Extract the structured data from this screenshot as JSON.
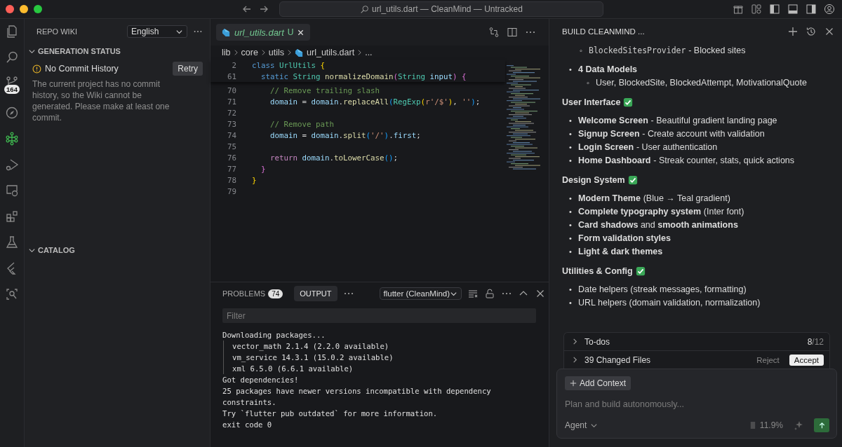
{
  "window": {
    "title": "url_utils.dart — CleanMind — Untracked"
  },
  "activity_bar": [
    {
      "kind": "files",
      "selected": false
    },
    {
      "kind": "search",
      "selected": false
    },
    {
      "kind": "source-control",
      "selected": false,
      "badge": "164"
    },
    {
      "kind": "compass",
      "selected": false
    },
    {
      "kind": "wiki",
      "selected": true
    },
    {
      "kind": "run-debug",
      "selected": false
    },
    {
      "kind": "remote",
      "selected": false
    },
    {
      "kind": "extensions",
      "selected": false
    },
    {
      "kind": "testing",
      "selected": false
    },
    {
      "kind": "flutter",
      "selected": false
    },
    {
      "kind": "inspect",
      "selected": false
    }
  ],
  "side_panel": {
    "title": "REPO WIKI",
    "language": "English",
    "sections": [
      {
        "title": "GENERATION STATUS",
        "expanded": true,
        "status": {
          "title": "No Commit History",
          "action": "Retry",
          "message": "The current project has no commit history, so the Wiki cannot be generated. Please make at least one commit."
        }
      },
      {
        "title": "CATALOG",
        "expanded": true
      }
    ]
  },
  "editor": {
    "tab": {
      "name": "url_utils.dart",
      "status": "U"
    },
    "breadcrumb": [
      "lib",
      "core",
      "utils",
      "url_utils.dart",
      "..."
    ],
    "sticky_lines": [
      {
        "number": "2",
        "tokens": [
          {
            "text": "class",
            "kind": "keyword"
          },
          {
            "text": " UrlUtils",
            "kind": "type"
          },
          {
            "text": " {",
            "kind": "bracket1"
          }
        ]
      },
      {
        "number": "61",
        "tokens": [
          {
            "text": "  static",
            "kind": "keyword"
          },
          {
            "text": " String",
            "kind": "type"
          },
          {
            "text": " normalizeDomain",
            "kind": "function"
          },
          {
            "text": "(",
            "kind": "bracket2"
          },
          {
            "text": "String",
            "kind": "type"
          },
          {
            "text": " input",
            "kind": "variable"
          },
          {
            "text": ")",
            "kind": "bracket2"
          },
          {
            "text": " {",
            "kind": "bracket2"
          }
        ]
      }
    ],
    "lines": [
      {
        "number": "70",
        "tokens": [
          {
            "text": "    // Remove trailing slash",
            "kind": "comment"
          }
        ]
      },
      {
        "number": "71",
        "tokens": [
          {
            "text": "    domain",
            "kind": "variable"
          },
          {
            "text": " = ",
            "kind": "plain"
          },
          {
            "text": "domain",
            "kind": "variable"
          },
          {
            "text": ".",
            "kind": "plain"
          },
          {
            "text": "replaceAll",
            "kind": "function"
          },
          {
            "text": "(",
            "kind": "bracket3"
          },
          {
            "text": "RegExp",
            "kind": "type"
          },
          {
            "text": "(",
            "kind": "bracket1"
          },
          {
            "text": "r'/$'",
            "kind": "string"
          },
          {
            "text": ")",
            "kind": "bracket1"
          },
          {
            "text": ", ",
            "kind": "plain"
          },
          {
            "text": "''",
            "kind": "string"
          },
          {
            "text": ")",
            "kind": "bracket3"
          },
          {
            "text": ";",
            "kind": "plain"
          }
        ]
      },
      {
        "number": "72"
      },
      {
        "number": "73",
        "tokens": [
          {
            "text": "    // Remove path",
            "kind": "comment"
          }
        ]
      },
      {
        "number": "74",
        "tokens": [
          {
            "text": "    domain",
            "kind": "variable"
          },
          {
            "text": " = ",
            "kind": "plain"
          },
          {
            "text": "domain",
            "kind": "variable"
          },
          {
            "text": ".",
            "kind": "plain"
          },
          {
            "text": "split",
            "kind": "function"
          },
          {
            "text": "(",
            "kind": "bracket3"
          },
          {
            "text": "'/'",
            "kind": "string"
          },
          {
            "text": ")",
            "kind": "bracket3"
          },
          {
            "text": ".",
            "kind": "plain"
          },
          {
            "text": "first",
            "kind": "variable"
          },
          {
            "text": ";",
            "kind": "plain"
          }
        ]
      },
      {
        "number": "75"
      },
      {
        "number": "76",
        "tokens": [
          {
            "text": "    return",
            "kind": "control"
          },
          {
            "text": " domain",
            "kind": "variable"
          },
          {
            "text": ".",
            "kind": "plain"
          },
          {
            "text": "toLowerCase",
            "kind": "function"
          },
          {
            "text": "()",
            "kind": "bracket3"
          },
          {
            "text": ";",
            "kind": "plain"
          }
        ]
      },
      {
        "number": "77",
        "tokens": [
          {
            "text": "  }",
            "kind": "bracket2"
          }
        ]
      },
      {
        "number": "78",
        "tokens": [
          {
            "text": "}",
            "kind": "bracket1"
          }
        ]
      },
      {
        "number": "79"
      }
    ]
  },
  "panel": {
    "tabs": [
      {
        "label": "PROBLEMS",
        "badge": "74",
        "selected": false
      },
      {
        "label": "OUTPUT",
        "selected": true
      }
    ],
    "channel": "flutter (CleanMind)",
    "filter_placeholder": "Filter",
    "output": [
      {
        "text": "Downloading packages...",
        "kind": "plain"
      },
      {
        "text": "vector_math 2.1.4 (2.2.0 available)",
        "kind": "nested"
      },
      {
        "text": "vm_service 14.3.1 (15.0.2 available)",
        "kind": "nested"
      },
      {
        "text": "xml 6.5.0 (6.6.1 available)",
        "kind": "nested"
      },
      {
        "text": "Got dependencies!",
        "kind": "plain"
      },
      {
        "text": "25 packages have newer versions incompatible with dependency constraints.",
        "kind": "plain"
      },
      {
        "text": "Try `flutter pub outdated` for more information.",
        "kind": "plain"
      },
      {
        "text": "exit code 0",
        "kind": "plain"
      }
    ]
  },
  "chat": {
    "title": "BUILD CLEANMIND ...",
    "blocks": [
      {
        "kind": "sublist",
        "items": [
          {
            "marker": "◦",
            "code": "BlockedSitesProvider",
            "text": "- Blocked sites"
          }
        ]
      },
      {
        "kind": "list",
        "items": [
          {
            "marker": "•",
            "title": "4 Data Models",
            "children": [
              {
                "marker": "◦",
                "text": "User, BlockedSite, BlockedAttempt, MotivationalQuote"
              }
            ]
          }
        ]
      },
      {
        "kind": "heading",
        "text": "User Interface"
      },
      {
        "kind": "list",
        "items": [
          {
            "marker": "•",
            "title": "Welcome Screen",
            "text": "- Beautiful gradient landing page"
          },
          {
            "marker": "•",
            "title": "Signup Screen",
            "text": "- Create account with validation"
          },
          {
            "marker": "•",
            "title": "Login Screen",
            "text": "- User authentication"
          },
          {
            "marker": "•",
            "title": "Home Dashboard",
            "text": "- Streak counter, stats, quick actions"
          }
        ]
      },
      {
        "kind": "heading",
        "text": "Design System"
      },
      {
        "kind": "list",
        "items": [
          {
            "marker": "•",
            "title": "Modern Theme",
            "text": "(Blue → Teal gradient)"
          },
          {
            "marker": "•",
            "title": "Complete typography system",
            "text": "(Inter font)"
          },
          {
            "marker": "•",
            "text": "**Card shadows** and **smooth animations**"
          },
          {
            "marker": "•",
            "title": "Form validation styles"
          },
          {
            "marker": "•",
            "title": "Light & dark themes"
          }
        ]
      },
      {
        "kind": "heading",
        "text": "Utilities & Config"
      },
      {
        "kind": "list",
        "items": [
          {
            "marker": "•",
            "text": "Date helpers (streak messages, formatting)"
          },
          {
            "marker": "•",
            "text": "URL helpers (domain validation, normalization)"
          }
        ]
      }
    ],
    "todos": {
      "label": "To-dos",
      "count": "8",
      "total": "/12"
    },
    "changes": {
      "label": "39 Changed Files",
      "reject": "Reject",
      "accept": "Accept"
    },
    "composer": {
      "add_context": "Add Context",
      "placeholder": "Plan and build autonomously...",
      "mode": "Agent",
      "usage": "11.9%"
    }
  }
}
